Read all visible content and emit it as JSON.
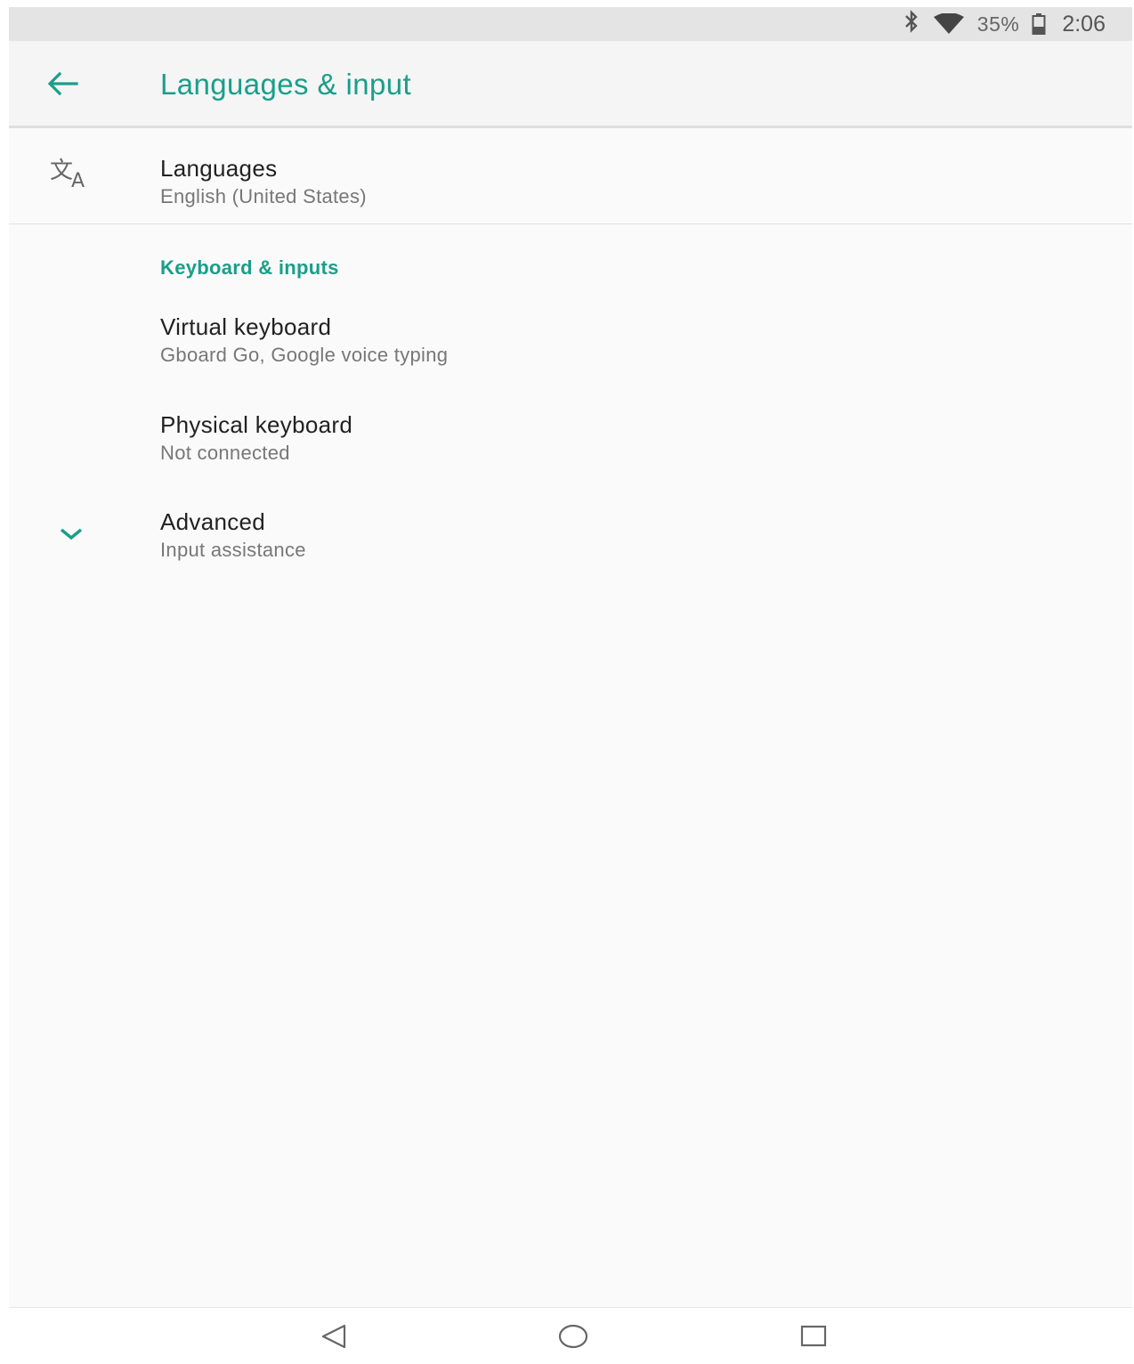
{
  "status_bar": {
    "icons": [
      "bluetooth-icon",
      "wifi-icon",
      "battery-icon"
    ],
    "battery_percent": "35%",
    "time": "2:06"
  },
  "app_bar": {
    "back_icon": "arrow-back-icon",
    "title": "Languages & input"
  },
  "languages": {
    "icon": "translate-icon",
    "title": "Languages",
    "summary": "English (United States)"
  },
  "keyboard_section": {
    "header": "Keyboard & inputs",
    "items": [
      {
        "title": "Virtual keyboard",
        "summary": "Gboard Go, Google voice typing"
      },
      {
        "title": "Physical keyboard",
        "summary": "Not connected"
      }
    ]
  },
  "advanced": {
    "icon": "chevron-down-icon",
    "title": "Advanced",
    "summary": "Input assistance"
  },
  "nav_bar": {
    "icons": [
      "back-triangle-icon",
      "home-circle-icon",
      "recents-square-icon"
    ]
  },
  "colors": {
    "accent": "#1a9e8a",
    "background": "#fafafa",
    "status_bar": "#e4e4e4"
  }
}
